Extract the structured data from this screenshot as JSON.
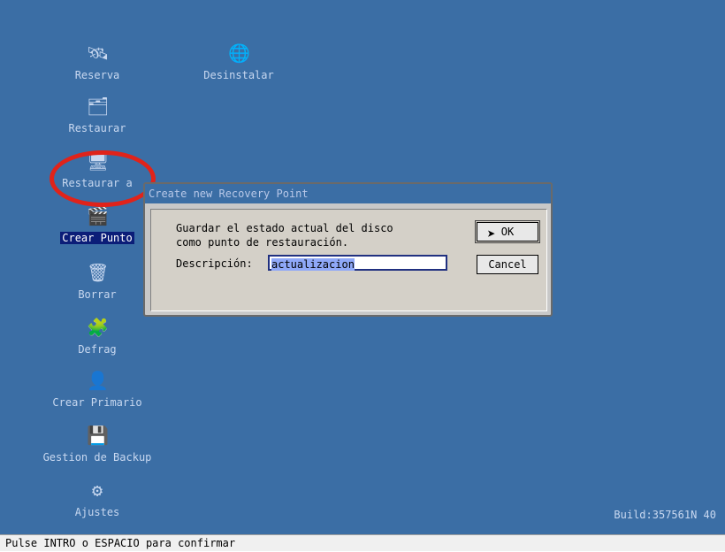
{
  "desktop_icons": [
    {
      "label": "Reserva",
      "icon": "reserve-icon"
    },
    {
      "label": "Desinstalar",
      "icon": "uninstall-icon"
    },
    {
      "label": "Restaurar",
      "icon": "restore-icon"
    },
    {
      "label": "Restaurar a",
      "icon": "restore-to-icon"
    },
    {
      "label": "Crear Punto",
      "icon": "create-point-icon",
      "selected": true
    },
    {
      "label": "Borrar",
      "icon": "delete-icon"
    },
    {
      "label": "Defrag",
      "icon": "defrag-icon"
    },
    {
      "label": "Crear Primario",
      "icon": "create-primary-icon"
    },
    {
      "label": "Gestion de Backup",
      "icon": "backup-management-icon"
    },
    {
      "label": "Ajustes",
      "icon": "settings-icon"
    }
  ],
  "dialog": {
    "title": "Create new Recovery Point",
    "message_line1": "Guardar el estado actual del disco",
    "message_line2": "como punto de restauración.",
    "description_label": "Descripción:",
    "description_value": "actualizacion",
    "ok_label": "OK",
    "cancel_label": "Cancel"
  },
  "build": "Build:357561N 40",
  "status_bar": "Pulse INTRO o ESPACIO para confirmar",
  "colors": {
    "desktop": "#3b6ea5",
    "highlight_ring": "#e0231a",
    "selection": "#0b1d78"
  }
}
